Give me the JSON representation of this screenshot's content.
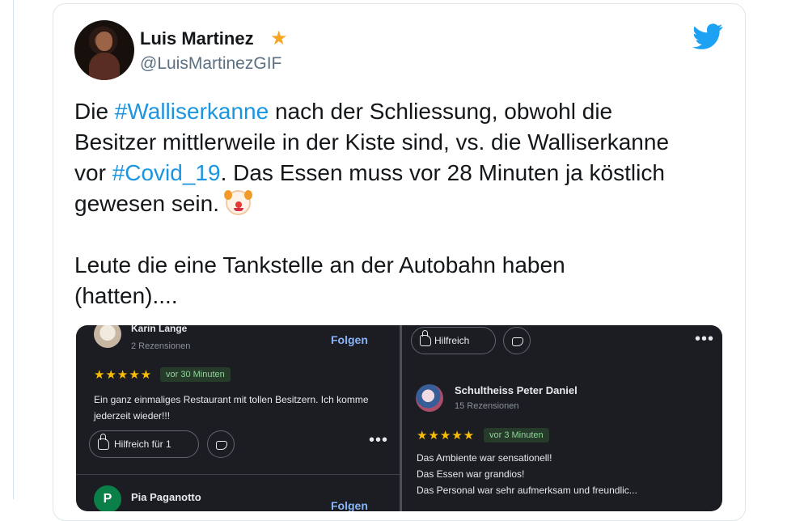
{
  "tweet": {
    "display_name": "Luis Martinez",
    "handle": "@LuisMartinezGIF",
    "verified_icon": "star-icon",
    "platform_icon": "twitter-bird-icon",
    "text_parts": [
      "Die ",
      "#Walliserkanne",
      " nach der Schliessung, obwohl die\nBesitzer mittlerweile in der Kiste sind, vs. die Walliserkanne\nvor ",
      "#Covid_19",
      ". Das Essen muss vor 28 Minuten ja köstlich\ngewesen sein. ",
      "\n\nLeute die eine Tankstelle an der Autobahn haben\n(hatten)...."
    ]
  },
  "media": {
    "left_panel": {
      "reviewer_1": {
        "name": "Karin Lange",
        "reviews": "2 Rezensionen",
        "follow": "Folgen",
        "stars": "★★★★★",
        "time": "vor 30 Minuten",
        "review": "Ein ganz einmaliges Restaurant mit tollen Besitzern. Ich komme jederzeit wieder!!!",
        "helpful": "Hilfreich für 1",
        "more": "•••"
      },
      "reviewer_2": {
        "avatar_initial": "P",
        "name": "Pia Paganotto",
        "follow": "Folgen"
      }
    },
    "right_panel": {
      "helpful": "Hilfreich",
      "more": "•••",
      "reviewer": {
        "name": "Schultheiss Peter Daniel",
        "reviews": "15 Rezensionen",
        "stars": "★★★★★",
        "time": "vor 3 Minuten",
        "review": "Das Ambiente war sensationell!\nDas Essen war grandios!\nDas Personal war sehr aufmerksam und freundlic..."
      }
    }
  },
  "colors": {
    "hashtag": "#1b95e0",
    "twitter_blue": "#1da1f2",
    "dark_panel": "#1b1d22",
    "follow_link": "#8ab4f8",
    "stars": "#fbbc04"
  }
}
